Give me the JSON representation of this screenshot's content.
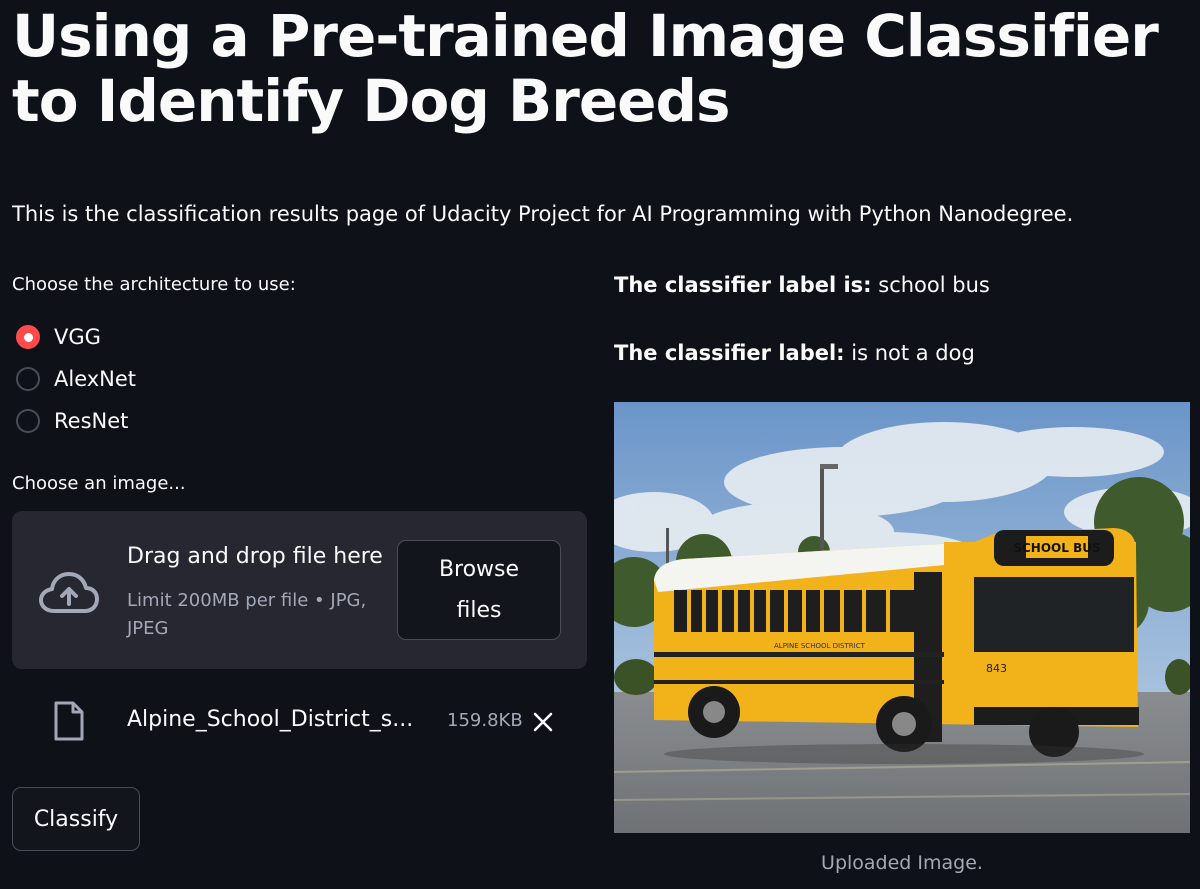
{
  "page": {
    "title": "Using a Pre-trained Image Classifier to Identify Dog Breeds",
    "intro": "This is the classification results page of Udacity Project for AI Programming with Python Nanodegree."
  },
  "architecture": {
    "label": "Choose the architecture to use:",
    "options": [
      "VGG",
      "AlexNet",
      "ResNet"
    ],
    "selected": "VGG"
  },
  "uploader": {
    "label": "Choose an image...",
    "drag_text": "Drag and drop file here",
    "limit_text": "Limit 200MB per file • JPG, JPEG",
    "browse_label": "Browse files",
    "file": {
      "name": "Alpine_School_District_s...",
      "size": "159.8KB"
    }
  },
  "classify_label": "Classify",
  "results": {
    "label_prefix": "The classifier label is:",
    "label_value": "school bus",
    "dog_prefix": "The classifier label:",
    "dog_value": "is not a dog"
  },
  "image": {
    "caption": "Uploaded Image.",
    "bus_sign": "SCHOOL BUS",
    "district_text": "ALPINE SCHOOL DISTRICT",
    "bus_number": "843"
  },
  "colors": {
    "background": "#0e1117",
    "panel": "#262730",
    "accent": "#ff4b4b",
    "text": "#fafafa",
    "muted": "#a3a8b8"
  }
}
